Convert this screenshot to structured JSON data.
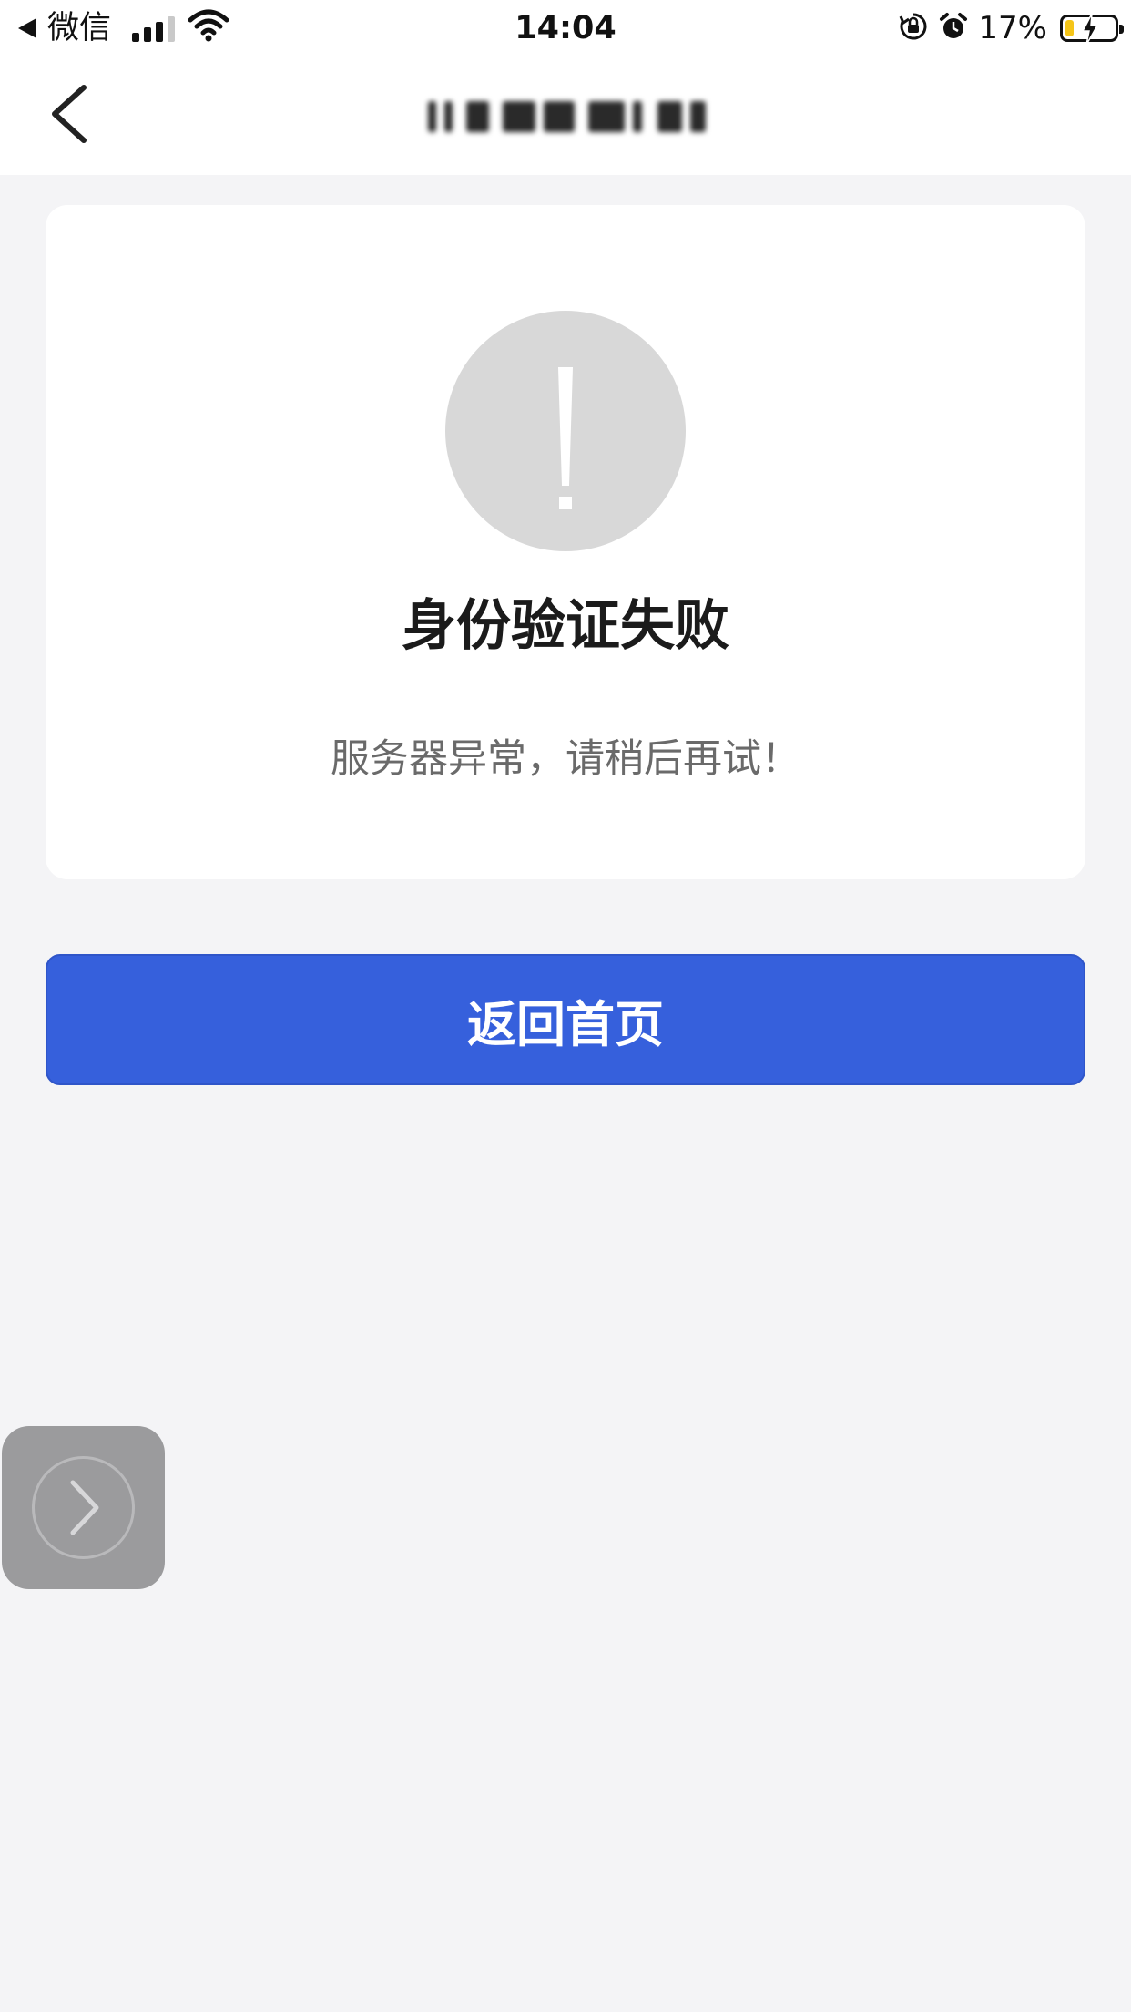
{
  "status_bar": {
    "back_app": "微信",
    "time": "14:04",
    "battery_percent": "17%",
    "battery_level": 0.17,
    "signal_bars_active": 3,
    "signal_bars_total": 4,
    "icons": [
      "back-triangle-icon",
      "signal-icon",
      "wifi-icon",
      "rotation-lock-icon",
      "alarm-icon",
      "battery-charging-icon"
    ]
  },
  "nav": {
    "back_icon": "chevron-left-icon",
    "title": "",
    "title_obscured": true
  },
  "result": {
    "icon": "exclamation-icon",
    "icon_color": "#d8d8d8",
    "title": "身份验证失败",
    "description": "服务器异常，请稍后再试！"
  },
  "actions": {
    "home_label": "返回首页",
    "home_color": "#3660dc"
  },
  "floating_button": {
    "icon": "chevron-right-icon"
  },
  "colors": {
    "background": "#f4f4f6",
    "card": "#ffffff",
    "primary": "#3660dc"
  }
}
